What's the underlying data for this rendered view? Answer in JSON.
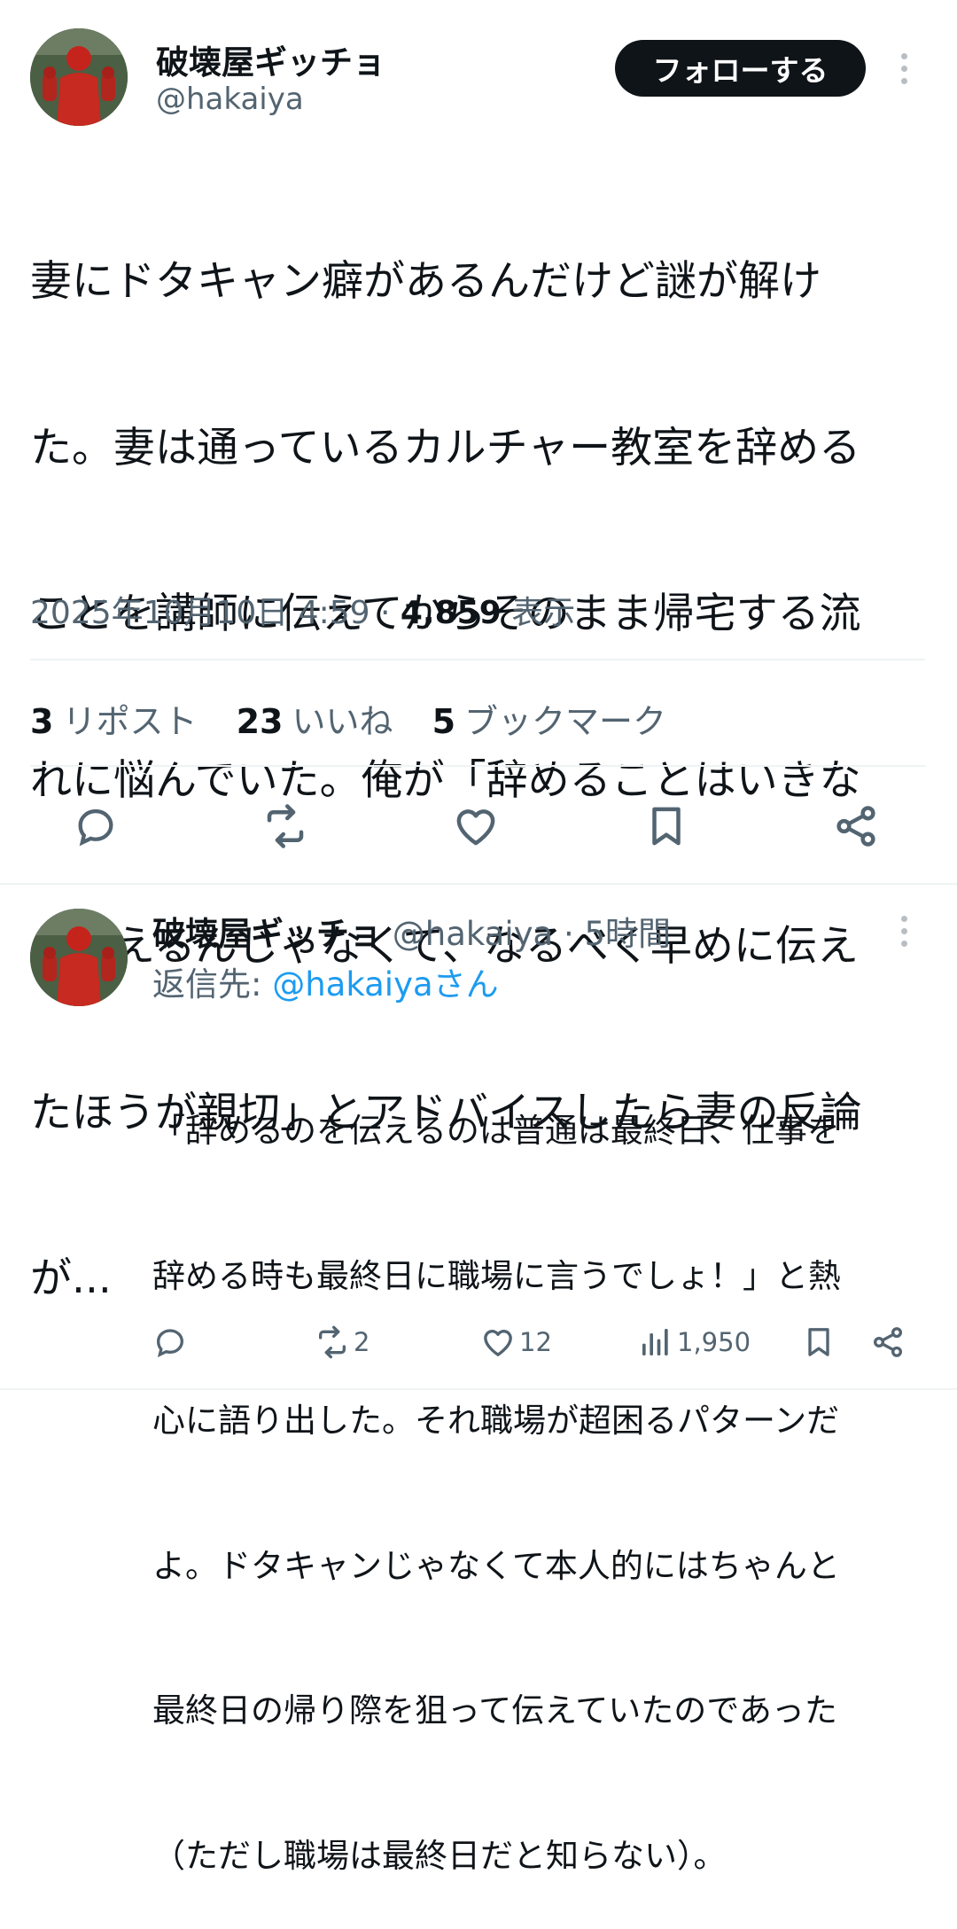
{
  "tweet": {
    "display_name": "破壊屋ギッチョ",
    "handle": "@hakaiya",
    "follow_label": "フォローする",
    "text_lines": [
      "妻にドタキャン癖があるんだけど謎が解け",
      "た。妻は通っているカルチャー教室を辞める",
      "ことを講師に伝えてからそのまま帰宅する流",
      "れに悩んでいた。俺が「辞めることはいきな",
      "り伝えるんじゃなくて、なるべく早めに伝え",
      "たほうが親切」とアドバイスしたら妻の反論",
      "が..."
    ],
    "datetime": "2025年10月10日 4:59",
    "views_count": "4,859",
    "views_label": "表示",
    "stats": {
      "reposts_count": "3",
      "reposts_label": "リポスト",
      "likes_count": "23",
      "likes_label": "いいね",
      "bookmarks_count": "5",
      "bookmarks_label": "ブックマーク"
    },
    "actions": [
      "reply-icon",
      "repost-icon",
      "like-icon",
      "bookmark-icon",
      "share-icon"
    ]
  },
  "reply": {
    "display_name": "破壊屋ギッチョ",
    "handle": "@hakaiya",
    "time": "5時間",
    "reply_to_label": "返信先:",
    "reply_to_handle": "@hakaiyaさん",
    "text_lines": [
      "「辞めるのを伝えるのは普通は最終日、仕事を",
      "辞める時も最終日に職場に言うでしょ！」と熱",
      "心に語り出した。それ職場が超困るパターンだ",
      "よ。ドタキャンじゃなくて本人的にはちゃんと",
      "最終日の帰り際を狙って伝えていたのであった",
      "（ただし職場は最終日だと知らない）。"
    ],
    "reposts": "2",
    "likes": "12",
    "views": "1,950"
  },
  "colors": {
    "text": "#0f1419",
    "secondary": "#536471",
    "link": "#1d9bf0",
    "divider": "#eff3f4",
    "button_bg": "#0f1419"
  }
}
